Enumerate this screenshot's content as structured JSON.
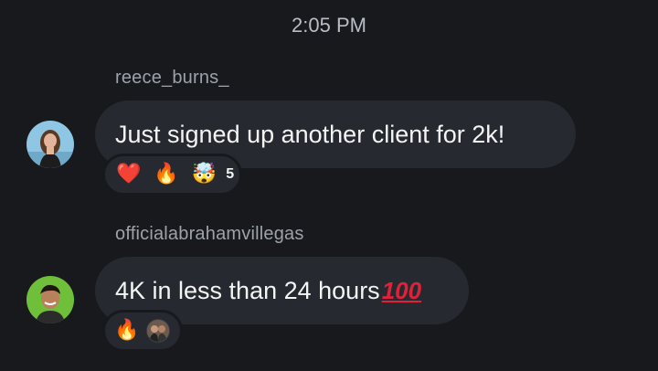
{
  "timestamp": "2:05 PM",
  "messages": [
    {
      "username": "reece_burns_",
      "text": "Just signed up another client for 2k!",
      "reactions": {
        "heart_icon": "❤️",
        "fire_icon": "🔥",
        "exploding_head_icon": "🤯",
        "count": "5"
      }
    },
    {
      "username": "officialabrahamvillegas",
      "text": "4K in less than 24 hours",
      "text_emoji": "100",
      "reactions": {
        "fire_icon": "🔥"
      }
    }
  ]
}
